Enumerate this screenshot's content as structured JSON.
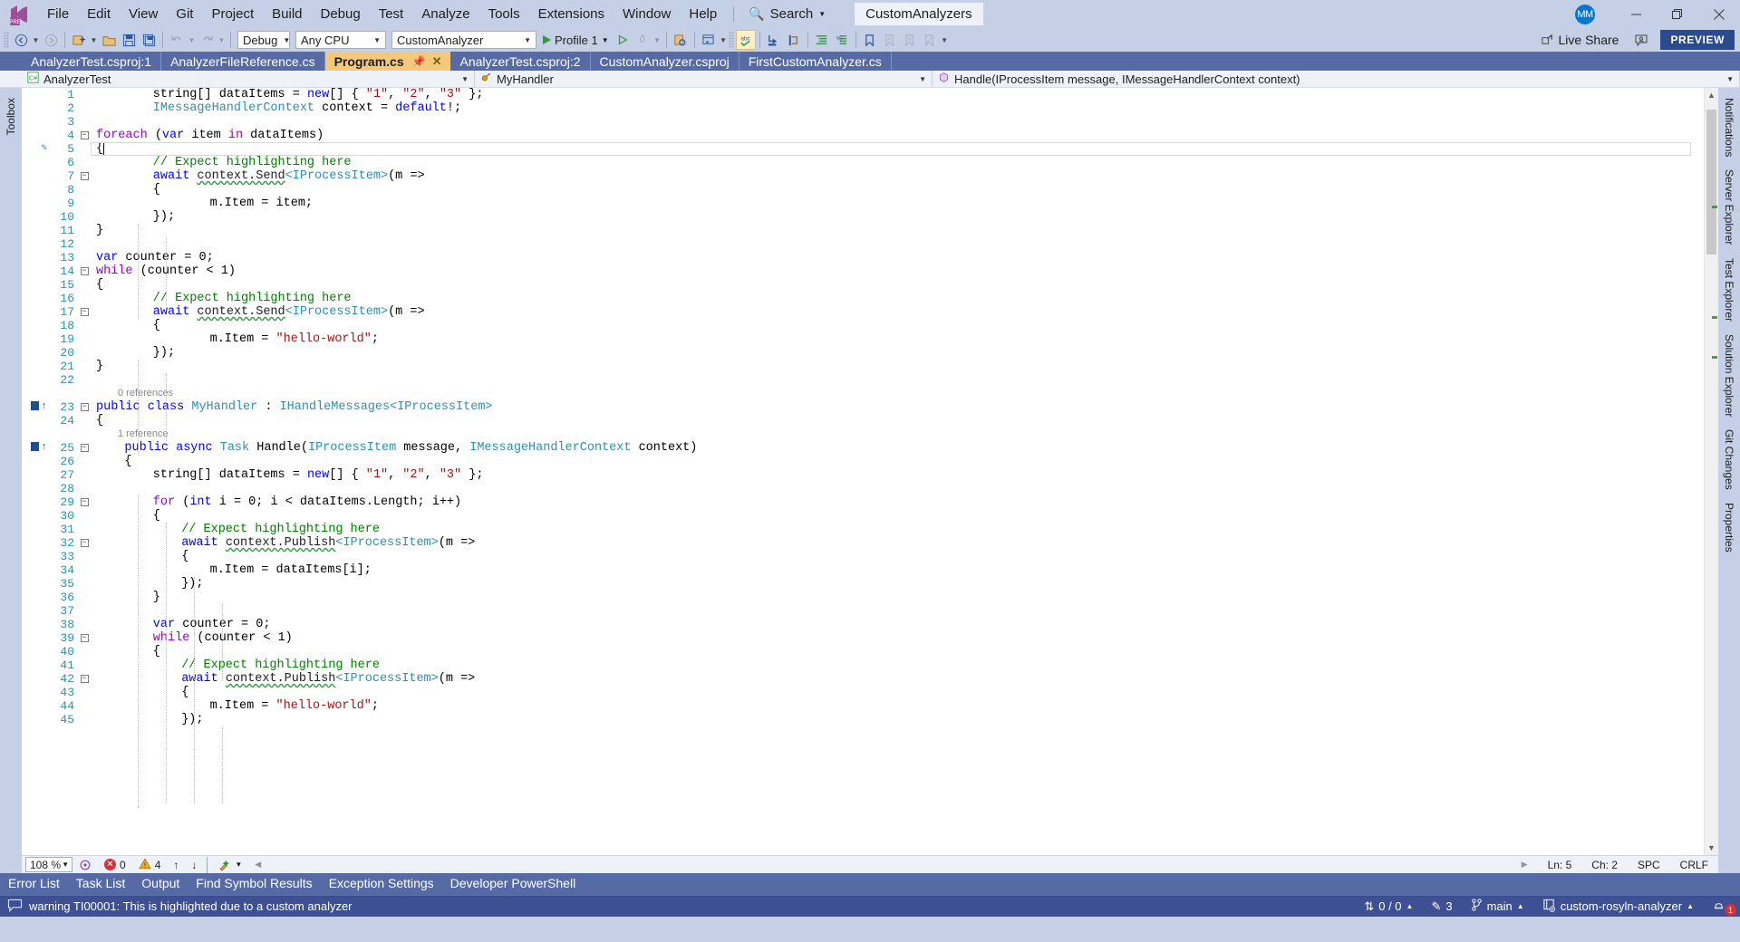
{
  "titlebar": {
    "logo_icon": "visual-studio-logo",
    "menus": [
      "File",
      "Edit",
      "View",
      "Git",
      "Project",
      "Build",
      "Debug",
      "Test",
      "Analyze",
      "Tools",
      "Extensions",
      "Window",
      "Help"
    ],
    "search_label": "Search",
    "search_icon": "magnifier-icon",
    "solution_name": "CustomAnalyzers",
    "avatar_initials": "MM",
    "minimize_icon": "minimize-icon",
    "restore_icon": "restore-icon",
    "close_icon": "close-icon"
  },
  "toolbar": {
    "config": "Debug",
    "platform": "Any CPU",
    "startup_project": "CustomAnalyzer",
    "run_label": "Profile 1",
    "live_share_label": "Live Share",
    "live_share_icon": "live-share-icon",
    "feedback_icon": "send-feedback-icon",
    "preview_badge": "PREVIEW",
    "icons": [
      "navigate-back-icon",
      "navigate-forward-icon",
      "new-project-icon",
      "open-file-icon",
      "save-icon",
      "save-all-icon",
      "undo-icon",
      "redo-icon",
      "attach-process-icon",
      "new-window-icon",
      "spell-check-icon",
      "step-into-icon",
      "step-over-icon",
      "comment-icon",
      "uncomment-icon",
      "bookmark-icon",
      "prev-bookmark-icon",
      "next-bookmark-icon",
      "clear-bookmarks-icon"
    ]
  },
  "tabs": [
    {
      "label": "AnalyzerTest.csproj:1",
      "active": false
    },
    {
      "label": "AnalyzerFileReference.cs",
      "active": false
    },
    {
      "label": "Program.cs",
      "active": true
    },
    {
      "label": "AnalyzerTest.csproj:2",
      "active": false
    },
    {
      "label": "CustomAnalyzer.csproj",
      "active": false
    },
    {
      "label": "FirstCustomAnalyzer.cs",
      "active": false
    }
  ],
  "navbar": {
    "project": "AnalyzerTest",
    "project_icon": "csharp-project-icon",
    "type": "MyHandler",
    "type_icon": "class-icon",
    "member": "Handle(IProcessItem message, IMessageHandlerContext context)",
    "member_icon": "method-icon"
  },
  "left_strip": [
    "Toolbox"
  ],
  "right_strip": [
    "Notifications",
    "Server Explorer",
    "Test Explorer",
    "Solution Explorer",
    "Git Changes",
    "Properties"
  ],
  "codelens": {
    "class_refs": "0 references",
    "method_refs": "1 reference"
  },
  "code_lines": [
    {
      "n": 1,
      "indent": 2,
      "fold": "",
      "tokens": [
        [
          "plain",
          "string"
        ],
        [
          "plain",
          "[] "
        ],
        [
          "id",
          "dataItems"
        ],
        [
          "plain",
          " = "
        ],
        [
          "kw",
          "new"
        ],
        [
          "plain",
          "[] { "
        ],
        [
          "str",
          "\"1\""
        ],
        [
          "plain",
          ", "
        ],
        [
          "str",
          "\"2\""
        ],
        [
          "plain",
          ", "
        ],
        [
          "str",
          "\"3\""
        ],
        [
          "plain",
          " };"
        ]
      ]
    },
    {
      "n": 2,
      "indent": 2,
      "fold": "",
      "tokens": [
        [
          "typ",
          "IMessageHandlerContext"
        ],
        [
          "plain",
          " "
        ],
        [
          "id",
          "context"
        ],
        [
          "plain",
          " = "
        ],
        [
          "kw",
          "default"
        ],
        [
          "plain",
          "!;"
        ]
      ]
    },
    {
      "n": 3,
      "indent": 0,
      "fold": "",
      "tokens": []
    },
    {
      "n": 4,
      "indent": 0,
      "fold": "-",
      "tokens": [
        [
          "kwc",
          "foreach"
        ],
        [
          "plain",
          " ("
        ],
        [
          "kw",
          "var"
        ],
        [
          "plain",
          " "
        ],
        [
          "id",
          "item"
        ],
        [
          "plain",
          " "
        ],
        [
          "kwc",
          "in"
        ],
        [
          "plain",
          " "
        ],
        [
          "id",
          "dataItems"
        ],
        [
          "plain",
          ")"
        ]
      ]
    },
    {
      "n": 5,
      "indent": 0,
      "fold": "",
      "tokens": [
        [
          "plain",
          "{"
        ]
      ],
      "current": true,
      "edit_mark": true
    },
    {
      "n": 6,
      "indent": 2,
      "fold": "",
      "tokens": [
        [
          "cmt",
          "// Expect highlighting here"
        ]
      ]
    },
    {
      "n": 7,
      "indent": 2,
      "fold": "-",
      "tokens": [
        [
          "kw",
          "await"
        ],
        [
          "plain",
          " "
        ],
        [
          "sq",
          "context.Send"
        ],
        [
          "typ",
          "<IProcessItem>"
        ],
        [
          "plain",
          "(m =>"
        ]
      ]
    },
    {
      "n": 8,
      "indent": 2,
      "fold": "",
      "tokens": [
        [
          "plain",
          "{"
        ]
      ]
    },
    {
      "n": 9,
      "indent": 4,
      "fold": "",
      "tokens": [
        [
          "id",
          "m.Item"
        ],
        [
          "plain",
          " = "
        ],
        [
          "id",
          "item"
        ],
        [
          "plain",
          ";"
        ]
      ]
    },
    {
      "n": 10,
      "indent": 2,
      "fold": "",
      "tokens": [
        [
          "plain",
          "});"
        ]
      ]
    },
    {
      "n": 11,
      "indent": 0,
      "fold": "",
      "tokens": [
        [
          "plain",
          "}"
        ]
      ]
    },
    {
      "n": 12,
      "indent": 0,
      "fold": "",
      "tokens": []
    },
    {
      "n": 13,
      "indent": 0,
      "fold": "",
      "tokens": [
        [
          "kw",
          "var"
        ],
        [
          "plain",
          " "
        ],
        [
          "id",
          "counter"
        ],
        [
          "plain",
          " = "
        ],
        [
          "num",
          "0"
        ],
        [
          "plain",
          ";"
        ]
      ]
    },
    {
      "n": 14,
      "indent": 0,
      "fold": "-",
      "tokens": [
        [
          "kwc",
          "while"
        ],
        [
          "plain",
          " ("
        ],
        [
          "id",
          "counter"
        ],
        [
          "plain",
          " < "
        ],
        [
          "num",
          "1"
        ],
        [
          "plain",
          ")"
        ]
      ]
    },
    {
      "n": 15,
      "indent": 0,
      "fold": "",
      "tokens": [
        [
          "plain",
          "{"
        ]
      ]
    },
    {
      "n": 16,
      "indent": 2,
      "fold": "",
      "tokens": [
        [
          "cmt",
          "// Expect highlighting here"
        ]
      ]
    },
    {
      "n": 17,
      "indent": 2,
      "fold": "-",
      "tokens": [
        [
          "kw",
          "await"
        ],
        [
          "plain",
          " "
        ],
        [
          "sq",
          "context.Send"
        ],
        [
          "typ",
          "<IProcessItem>"
        ],
        [
          "plain",
          "(m =>"
        ]
      ]
    },
    {
      "n": 18,
      "indent": 2,
      "fold": "",
      "tokens": [
        [
          "plain",
          "{"
        ]
      ]
    },
    {
      "n": 19,
      "indent": 4,
      "fold": "",
      "tokens": [
        [
          "id",
          "m.Item"
        ],
        [
          "plain",
          " = "
        ],
        [
          "str",
          "\"hello-world\""
        ],
        [
          "plain",
          ";"
        ]
      ]
    },
    {
      "n": 20,
      "indent": 2,
      "fold": "",
      "tokens": [
        [
          "plain",
          "});"
        ]
      ]
    },
    {
      "n": 21,
      "indent": 0,
      "fold": "",
      "tokens": [
        [
          "plain",
          "}"
        ]
      ]
    },
    {
      "n": 22,
      "indent": 0,
      "fold": "",
      "tokens": []
    },
    {
      "n": 23,
      "indent": 0,
      "fold": "-",
      "tokens": [
        [
          "kw",
          "public"
        ],
        [
          "plain",
          " "
        ],
        [
          "kw",
          "class"
        ],
        [
          "plain",
          " "
        ],
        [
          "typ",
          "MyHandler"
        ],
        [
          "plain",
          " : "
        ],
        [
          "typ",
          "IHandleMessages"
        ],
        [
          "typ",
          "<IProcessItem>"
        ]
      ],
      "lens": "class_refs",
      "refbar": true
    },
    {
      "n": 24,
      "indent": 0,
      "fold": "",
      "tokens": [
        [
          "plain",
          "{"
        ]
      ]
    },
    {
      "n": 25,
      "indent": 1,
      "fold": "-",
      "tokens": [
        [
          "kw",
          "public"
        ],
        [
          "plain",
          " "
        ],
        [
          "kw",
          "async"
        ],
        [
          "plain",
          " "
        ],
        [
          "typ",
          "Task"
        ],
        [
          "plain",
          " "
        ],
        [
          "id",
          "Handle"
        ],
        [
          "plain",
          "("
        ],
        [
          "typ",
          "IProcessItem"
        ],
        [
          "plain",
          " "
        ],
        [
          "id",
          "message"
        ],
        [
          "plain",
          ", "
        ],
        [
          "typ",
          "IMessageHandlerContext"
        ],
        [
          "plain",
          " "
        ],
        [
          "id",
          "context"
        ],
        [
          "plain",
          ")"
        ]
      ],
      "lens": "method_refs",
      "refbar": true
    },
    {
      "n": 26,
      "indent": 1,
      "fold": "",
      "tokens": [
        [
          "plain",
          "{"
        ]
      ]
    },
    {
      "n": 27,
      "indent": 2,
      "fold": "",
      "tokens": [
        [
          "plain",
          "string"
        ],
        [
          "plain",
          "[] "
        ],
        [
          "id",
          "dataItems"
        ],
        [
          "plain",
          " = "
        ],
        [
          "kw",
          "new"
        ],
        [
          "plain",
          "[] { "
        ],
        [
          "str",
          "\"1\""
        ],
        [
          "plain",
          ", "
        ],
        [
          "str",
          "\"2\""
        ],
        [
          "plain",
          ", "
        ],
        [
          "str",
          "\"3\""
        ],
        [
          "plain",
          " };"
        ]
      ]
    },
    {
      "n": 28,
      "indent": 0,
      "fold": "",
      "tokens": []
    },
    {
      "n": 29,
      "indent": 2,
      "fold": "-",
      "tokens": [
        [
          "kwc",
          "for"
        ],
        [
          "plain",
          " ("
        ],
        [
          "kw",
          "int"
        ],
        [
          "plain",
          " "
        ],
        [
          "id",
          "i"
        ],
        [
          "plain",
          " = "
        ],
        [
          "num",
          "0"
        ],
        [
          "plain",
          "; "
        ],
        [
          "id",
          "i"
        ],
        [
          "plain",
          " < "
        ],
        [
          "id",
          "dataItems.Length"
        ],
        [
          "plain",
          "; "
        ],
        [
          "id",
          "i"
        ],
        [
          "plain",
          "++)"
        ]
      ]
    },
    {
      "n": 30,
      "indent": 2,
      "fold": "",
      "tokens": [
        [
          "plain",
          "{"
        ]
      ]
    },
    {
      "n": 31,
      "indent": 3,
      "fold": "",
      "tokens": [
        [
          "cmt",
          "// Expect highlighting here"
        ]
      ]
    },
    {
      "n": 32,
      "indent": 3,
      "fold": "-",
      "tokens": [
        [
          "kw",
          "await"
        ],
        [
          "plain",
          " "
        ],
        [
          "sq",
          "context.Publish"
        ],
        [
          "typ",
          "<IProcessItem>"
        ],
        [
          "plain",
          "(m =>"
        ]
      ]
    },
    {
      "n": 33,
      "indent": 3,
      "fold": "",
      "tokens": [
        [
          "plain",
          "{"
        ]
      ]
    },
    {
      "n": 34,
      "indent": 4,
      "fold": "",
      "tokens": [
        [
          "id",
          "m.Item"
        ],
        [
          "plain",
          " = "
        ],
        [
          "id",
          "dataItems"
        ],
        [
          "plain",
          "["
        ],
        [
          "id",
          "i"
        ],
        [
          "plain",
          "];"
        ]
      ]
    },
    {
      "n": 35,
      "indent": 3,
      "fold": "",
      "tokens": [
        [
          "plain",
          "});"
        ]
      ]
    },
    {
      "n": 36,
      "indent": 2,
      "fold": "",
      "tokens": [
        [
          "plain",
          "}"
        ]
      ]
    },
    {
      "n": 37,
      "indent": 0,
      "fold": "",
      "tokens": []
    },
    {
      "n": 38,
      "indent": 2,
      "fold": "",
      "tokens": [
        [
          "kw",
          "var"
        ],
        [
          "plain",
          " "
        ],
        [
          "id",
          "counter"
        ],
        [
          "plain",
          " = "
        ],
        [
          "num",
          "0"
        ],
        [
          "plain",
          ";"
        ]
      ]
    },
    {
      "n": 39,
      "indent": 2,
      "fold": "-",
      "tokens": [
        [
          "kwc",
          "while"
        ],
        [
          "plain",
          " ("
        ],
        [
          "id",
          "counter"
        ],
        [
          "plain",
          " < "
        ],
        [
          "num",
          "1"
        ],
        [
          "plain",
          ")"
        ]
      ]
    },
    {
      "n": 40,
      "indent": 2,
      "fold": "",
      "tokens": [
        [
          "plain",
          "{"
        ]
      ]
    },
    {
      "n": 41,
      "indent": 3,
      "fold": "",
      "tokens": [
        [
          "cmt",
          "// Expect highlighting here"
        ]
      ]
    },
    {
      "n": 42,
      "indent": 3,
      "fold": "-",
      "tokens": [
        [
          "kw",
          "await"
        ],
        [
          "plain",
          " "
        ],
        [
          "sq",
          "context.Publish"
        ],
        [
          "typ",
          "<IProcessItem>"
        ],
        [
          "plain",
          "(m =>"
        ]
      ]
    },
    {
      "n": 43,
      "indent": 3,
      "fold": "",
      "tokens": [
        [
          "plain",
          "{"
        ]
      ]
    },
    {
      "n": 44,
      "indent": 4,
      "fold": "",
      "tokens": [
        [
          "id",
          "m.Item"
        ],
        [
          "plain",
          " = "
        ],
        [
          "str",
          "\"hello-world\""
        ],
        [
          "plain",
          ";"
        ]
      ]
    },
    {
      "n": 45,
      "indent": 3,
      "fold": "",
      "tokens": [
        [
          "plain",
          "});"
        ]
      ]
    }
  ],
  "editor_status": {
    "zoom": "108 %",
    "errors": "0",
    "warnings": "4",
    "prev_icon": "up-arrow-icon",
    "next_icon": "down-arrow-icon",
    "cleanup_icon": "code-cleanup-icon",
    "ln": "Ln: 5",
    "ch": "Ch: 2",
    "spaces": "SPC",
    "eol": "CRLF"
  },
  "bottom_tabs": [
    "Error List",
    "Task List",
    "Output",
    "Find Symbol Results",
    "Exception Settings",
    "Developer PowerShell"
  ],
  "statusbar": {
    "message_icon": "speech-bubble-icon",
    "message": "warning TI00001: This is highlighted due to a custom analyzer",
    "source_control_sync": "0 / 0",
    "sync_icon": "up-down-arrow-icon",
    "pending_changes": "3",
    "pencil_icon": "pencil-icon",
    "branch": "main",
    "branch_icon": "branch-icon",
    "repo": "custom-rosyln-analyzer",
    "repo_icon": "repository-icon",
    "notification_icon": "bell-icon",
    "notification_count": "1"
  },
  "colors": {
    "title_bg": "#c5cfe5",
    "tabstrip_bg": "#566ba5",
    "active_tab_bg": "#f5c97c",
    "statusbar_bg": "#3d5093",
    "preview_badge_bg": "#2b4b8c",
    "editor_bg": "#ffffff",
    "linenum": "#2b91af",
    "keyword": "#0000ff",
    "control_keyword": "#8f08c4",
    "type": "#2b91af",
    "string": "#a31515",
    "comment": "#008000",
    "squiggle": "#2e9c3a"
  }
}
